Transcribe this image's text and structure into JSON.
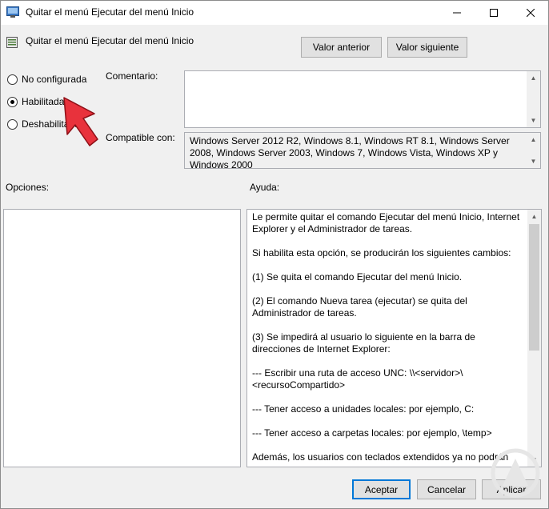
{
  "window": {
    "title": "Quitar el menú Ejecutar del menú Inicio",
    "minimize_glyph": "—",
    "maximize_glyph": "☐",
    "close_glyph": "✕"
  },
  "policy": {
    "title": "Quitar el menú Ejecutar del menú Inicio"
  },
  "nav": {
    "prev_label": "Valor anterior",
    "next_label": "Valor siguiente"
  },
  "state_options": [
    {
      "label": "No configurada",
      "selected": false
    },
    {
      "label": "Habilitada",
      "selected": true
    },
    {
      "label": "Deshabilitada",
      "selected": false
    }
  ],
  "comment": {
    "label": "Comentario:",
    "value": ""
  },
  "compatible": {
    "label": "Compatible con:",
    "value": "Windows Server 2012 R2, Windows 8.1, Windows RT 8.1, Windows Server 2008, Windows Server 2003, Windows 7, Windows Vista, Windows XP y Windows 2000"
  },
  "options": {
    "label": "Opciones:"
  },
  "help": {
    "label": "Ayuda:",
    "paragraphs": [
      "Le permite quitar el comando Ejecutar del menú Inicio, Internet Explorer y el Administrador de tareas.",
      "Si habilita esta opción, se producirán los siguientes cambios:",
      "(1) Se quita el comando Ejecutar del menú Inicio.",
      "(2) El comando Nueva tarea (ejecutar) se quita del Administrador de tareas.",
      "(3) Se impedirá al usuario lo siguiente en la barra de direcciones de Internet Explorer:",
      "--- Escribir una ruta de acceso UNC: \\\\<servidor>\\<recursoCompartido>",
      "--- Tener acceso a unidades locales: por ejemplo, C:",
      "--- Tener acceso a carpetas locales: por ejemplo, \\temp>",
      "Además, los usuarios con teclados extendidos ya no podrán"
    ]
  },
  "footer": {
    "ok_label": "Aceptar",
    "cancel_label": "Cancelar",
    "apply_label": "Aplicar"
  },
  "colors": {
    "accent": "#0078d7",
    "pointer_arrow": "#e8323c"
  }
}
